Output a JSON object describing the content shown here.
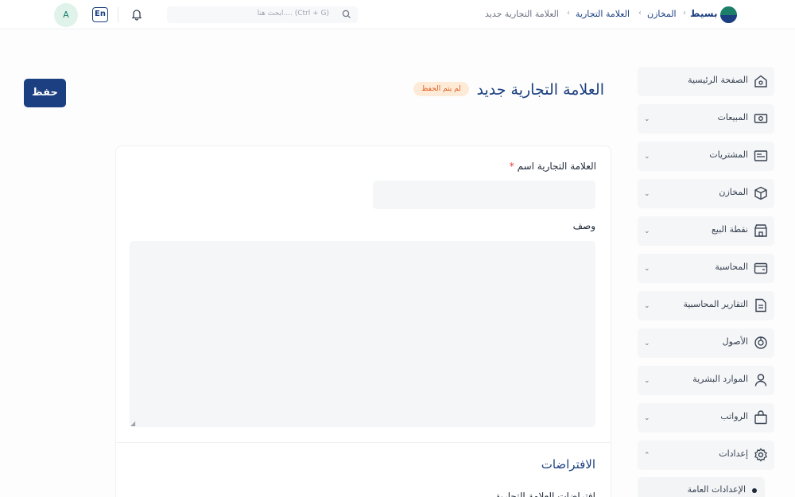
{
  "header": {
    "brand": "بسيط",
    "breadcrumbs": [
      "المخازن",
      "العلامة التجارية",
      "العلامة التجارية جديد"
    ],
    "search_placeholder": "ابحث هنا.... (Ctrl + G)",
    "lang_label": "En",
    "avatar_initial": "A"
  },
  "sidebar": {
    "items": [
      {
        "label": "الصفحة الرئيسية",
        "icon": "home-icon"
      },
      {
        "label": "المبيعات",
        "icon": "cash-icon"
      },
      {
        "label": "المشتريات",
        "icon": "invoice-icon"
      },
      {
        "label": "المخازن",
        "icon": "box-icon"
      },
      {
        "label": "نقطة البيع",
        "icon": "store-icon"
      },
      {
        "label": "المحاسبة",
        "icon": "wallet-icon"
      },
      {
        "label": "التقارير المحاسبية",
        "icon": "report-icon"
      },
      {
        "label": "الأصول",
        "icon": "asset-icon"
      },
      {
        "label": "الموارد البشرية",
        "icon": "person-icon"
      },
      {
        "label": "الرواتب",
        "icon": "bag-icon"
      },
      {
        "label": "إعدادات",
        "icon": "settings-icon"
      }
    ],
    "sub_item": "الإعدادات العامة"
  },
  "page": {
    "title": "العلامة التجارية جديد",
    "unsaved_badge": "لم يتم الحفظ",
    "save_label": "حفظ"
  },
  "form": {
    "name_label": "العلامة التجارية اسم",
    "required_mark": "*",
    "name_value": "",
    "desc_label": "وصف",
    "desc_value": "",
    "defaults_title": "الافتراضات",
    "defaults_subtitle": "افتراضات العلامة التجارية"
  },
  "colors": {
    "primary": "#1b3f80",
    "badge_bg": "#fdebd8",
    "badge_text": "#e05a1f",
    "required": "#e53935"
  }
}
